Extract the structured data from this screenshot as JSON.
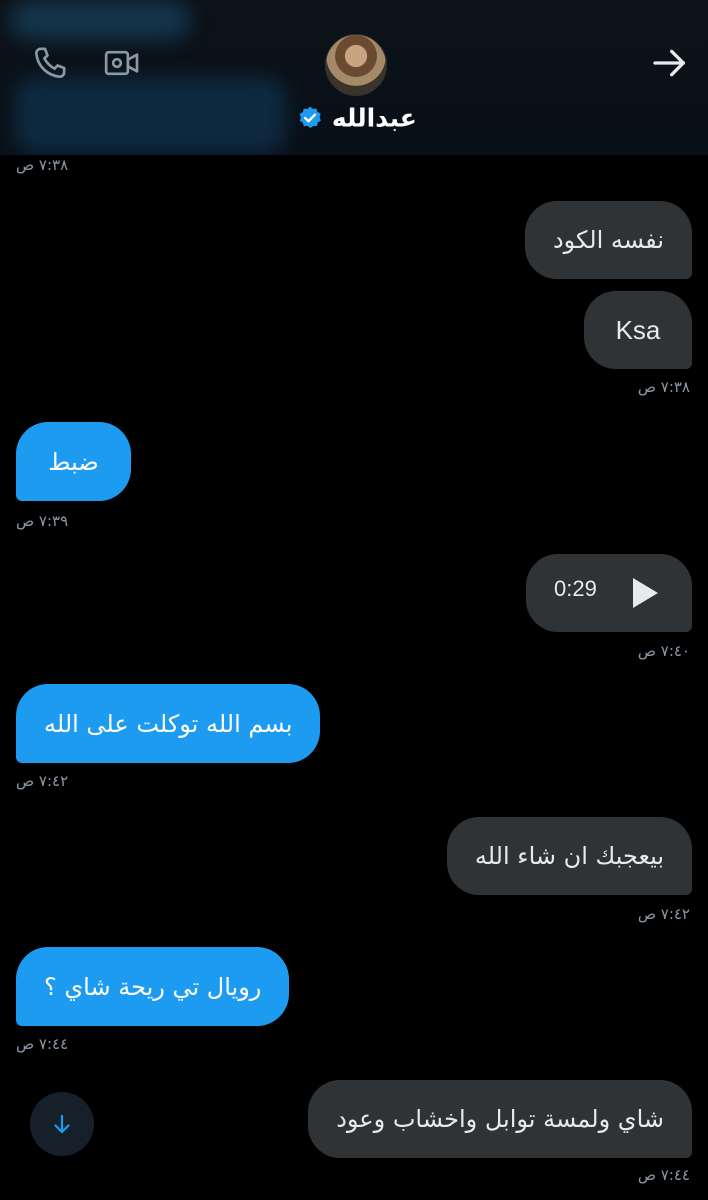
{
  "header": {
    "contact_name": "عبدالله",
    "icons": {
      "call": "phone-icon",
      "video": "video-icon",
      "back": "arrow-right-icon",
      "verified": "verified-badge-icon"
    }
  },
  "messages": [
    {
      "id": "ts0",
      "kind": "timestamp",
      "side": "in",
      "time": "٧:٣٨ ص"
    },
    {
      "id": "m1",
      "kind": "text",
      "side": "out",
      "text": "نفسه الكود"
    },
    {
      "id": "m2",
      "kind": "text",
      "side": "out",
      "text": "Ksa",
      "time": "٧:٣٨ ص"
    },
    {
      "id": "m3",
      "kind": "text",
      "side": "in",
      "text": "ضبط",
      "time": "٧:٣٩ ص"
    },
    {
      "id": "m4",
      "kind": "voice",
      "side": "out",
      "duration": "0:29",
      "time": "٧:٤٠ ص"
    },
    {
      "id": "m5",
      "kind": "text",
      "side": "in",
      "text": "بسم الله توكلت على الله",
      "time": "٧:٤٢ ص"
    },
    {
      "id": "m6",
      "kind": "text",
      "side": "out",
      "text": "بيعجبك ان شاء الله",
      "time": "٧:٤٢ ص"
    },
    {
      "id": "m7",
      "kind": "text",
      "side": "in",
      "text": "رويال تي ريحة شاي ؟",
      "time": "٧:٤٤ ص"
    },
    {
      "id": "m8",
      "kind": "text",
      "side": "out",
      "text": "شاي ولمسة توابل واخشاب وعود",
      "time": "٧:٤٤ ص"
    }
  ],
  "colors": {
    "incoming_bubble": "#1d9bf0",
    "outgoing_bubble": "#2f3336",
    "background": "#000000",
    "timestamp": "#8b98a5"
  },
  "scroll_button": {
    "icon": "arrow-down-icon"
  }
}
